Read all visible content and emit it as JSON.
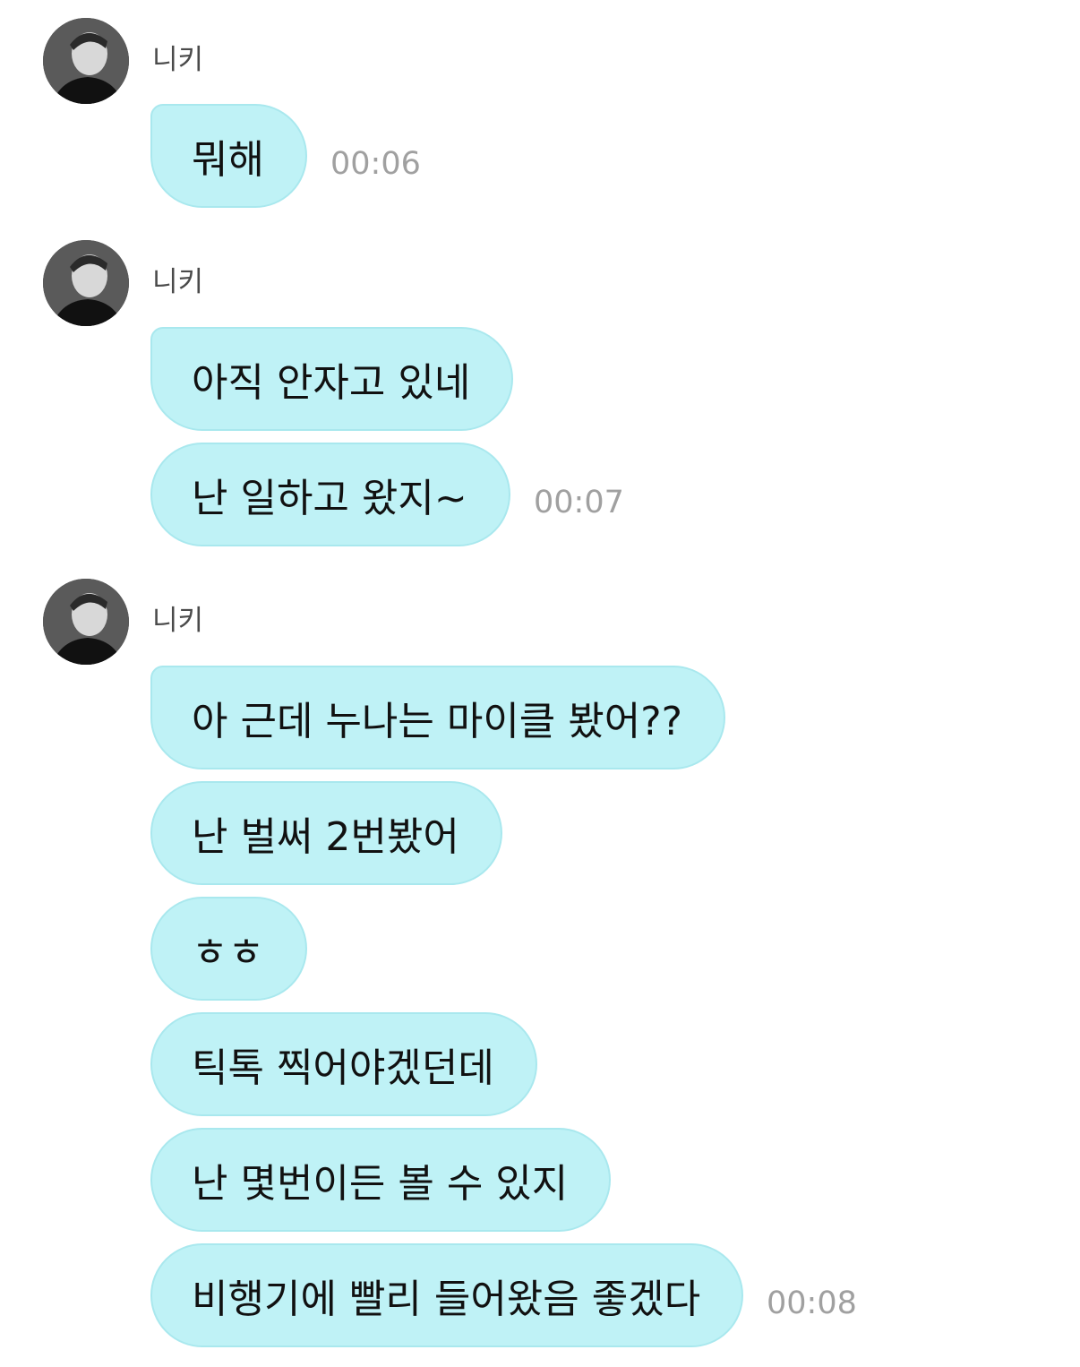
{
  "groups": [
    {
      "sender": "니키",
      "messages": [
        "뭐해"
      ],
      "time": "00:06"
    },
    {
      "sender": "니키",
      "messages": [
        "아직 안자고 있네",
        "난 일하고 왔지~"
      ],
      "time": "00:07"
    },
    {
      "sender": "니키",
      "messages": [
        "아 근데 누나는 마이클 봤어??",
        "난 벌써 2번봤어",
        "ㅎㅎ",
        "틱톡 찍어야겠던데",
        "난 몇번이든 볼 수 있지",
        "비행기에 빨리 들어왔음 좋겠다"
      ],
      "time": "00:08"
    }
  ],
  "colors": {
    "bubble": "#bff2f6",
    "bubble_border": "#a9e8ee",
    "time": "#a0a0a0",
    "name": "#4a4a4a"
  }
}
